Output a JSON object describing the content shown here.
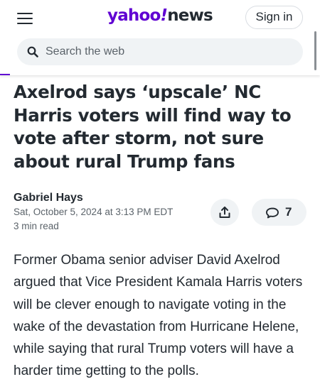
{
  "header": {
    "logo_brand": "yahoo",
    "logo_bang": "!",
    "logo_section": "news",
    "signin_label": "Sign in",
    "brand_color": "#6001d2"
  },
  "search": {
    "placeholder": "Search the web",
    "value": ""
  },
  "icons": {
    "menu": "hamburger-menu-icon",
    "search": "magnifier-icon",
    "share": "share-upload-icon",
    "comments": "chat-bubble-icon"
  },
  "article": {
    "headline": "Axelrod says ‘upscale’ NC Harris voters will find way to vote after storm, not sure about rural Trump fans",
    "author": "Gabriel Hays",
    "date": "Sat, October 5, 2024 at 3:13 PM EDT",
    "read_time": "3 min read",
    "comment_count": "7",
    "body": "Former Obama senior adviser David Axelrod argued that Vice President Kamala Harris voters will be clever enough to navigate voting in the wake of the devastation from Hurricane Helene, while saying that rural Trump voters will have a harder time getting to the polls."
  }
}
